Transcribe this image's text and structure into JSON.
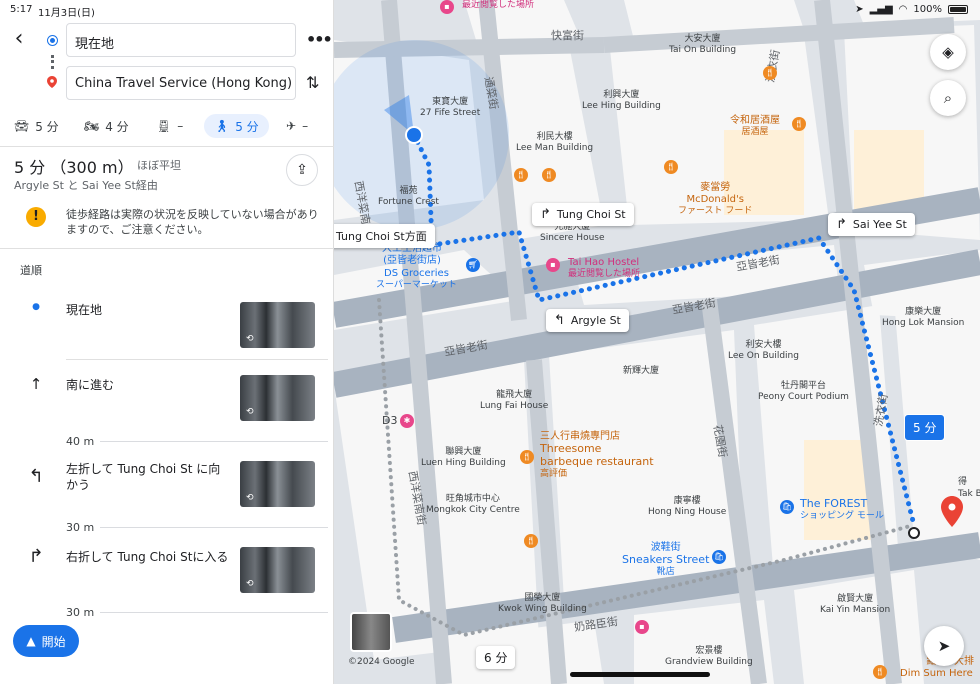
{
  "status_bar": {
    "time": "5:17",
    "date": "11月3日(日)",
    "battery": "100%"
  },
  "route": {
    "origin": "現在地",
    "destination": "China Travel Service (Hong Kong) L…"
  },
  "modes": [
    {
      "name": "car",
      "value": "5 分"
    },
    {
      "name": "motorcycle",
      "value": "4 分"
    },
    {
      "name": "transit",
      "value": "–"
    },
    {
      "name": "walk",
      "value": "5 分"
    },
    {
      "name": "flight",
      "value": "–"
    }
  ],
  "summary": {
    "time": "5 分 （300 m）",
    "terrain": "ほぼ平坦",
    "via": "Argyle St と Sai Yee St経由"
  },
  "warning": "徒歩経路は実際の状況を反映していない場合がありますので、ご注意ください。",
  "steps_title": "道順",
  "steps": [
    {
      "icon": "current-location-icon",
      "text": "現在地"
    },
    {
      "icon": "straight-arrow-icon",
      "text": "南に進む",
      "distance": "40 m"
    },
    {
      "icon": "turn-left-icon",
      "text": "左折して Tung Choi St に向かう",
      "distance": "30 m"
    },
    {
      "icon": "turn-right-icon",
      "text": "右折して Tung Choi Stに入る",
      "distance": "30 m"
    }
  ],
  "start_button": "開始",
  "map": {
    "callouts": {
      "tung_choi_dir": "Tung Choi St方面",
      "tung_choi": "Tung Choi St",
      "argyle": "Argyle St",
      "sai_yee": "Sai Yee St"
    },
    "time_main": "5 分",
    "time_alt": "6 分",
    "copyright": "©2024 Google",
    "places": {
      "visited": "最近閲覧した場所",
      "tai_on": [
        "大安大廈",
        "Tai On Building"
      ],
      "lee_hing": [
        "利興大廈",
        "Lee Hing Building"
      ],
      "fife": [
        "東寶大廈",
        "27 Fife Street"
      ],
      "lee_man": [
        "利民大樓",
        "Lee Man Building"
      ],
      "lingwu": [
        "令和居酒屋",
        "居酒屋"
      ],
      "mcd": [
        "麥當勞",
        "McDonald's",
        "ファースト フード"
      ],
      "fortune": [
        "福苑",
        "Fortune Crest"
      ],
      "sincere": [
        "先施大廈",
        "Sincere House"
      ],
      "tai_hao": [
        "Tai Hao Hostel",
        "最近閲覧した場所"
      ],
      "ds_groc_cn": "大王生活超市",
      "ds_groc_cn2": "(亞皆老街店)",
      "ds_groc": [
        "DS Groceries",
        "スーパーマーケット"
      ],
      "hong_lok": [
        "康樂大廈",
        "Hong Lok Mansion"
      ],
      "lee_on": [
        "利安大樓",
        "Lee On Building"
      ],
      "xinhui": "新輝大廈",
      "peony": [
        "牡丹閣平台",
        "Peony Court Podium"
      ],
      "lung_fai": [
        "龍飛大廈",
        "Lung Fai House"
      ],
      "d3": "D3",
      "luen_hing": [
        "聯興大廈",
        "Luen Hing Building"
      ],
      "threesome": [
        "三人行串燒專門店",
        "Threesome",
        "barbeque restaurant",
        "高評価"
      ],
      "mongkok_cc": [
        "旺角城市中心",
        "Mongkok City Centre"
      ],
      "hong_ning": [
        "康寧樓",
        "Hong Ning House"
      ],
      "forest": [
        "The FOREST",
        "ショッピング モール"
      ],
      "sneakers": [
        "波鞋街",
        "Sneakers Street",
        "靴店"
      ],
      "kwok_wing": [
        "國榮大廈",
        "Kwok Wing Building"
      ],
      "kai_yin": [
        "啟賢大廈",
        "Kai Yin Mansion"
      ],
      "grandview": [
        "宏景樓",
        "Grandview Building"
      ],
      "dim_sum": [
        "點心",
        "Dim Sum Here"
      ],
      "tak_bo": "Tak B",
      "de": "得",
      "paixu": "大排"
    },
    "roads": {
      "kwong_wa": "快富街",
      "tung_choi": "通菜街",
      "sai_yeung_choi": "西洋菜南街",
      "fa_yuen": "花園街",
      "sai_yee": "洗衣街",
      "argyle1": "亞皆老街",
      "argyle2": "亞皆老街",
      "argyle3": "亞皆老街",
      "nelson": "奶路臣街",
      "sai_yee2": "洗衣街"
    }
  }
}
